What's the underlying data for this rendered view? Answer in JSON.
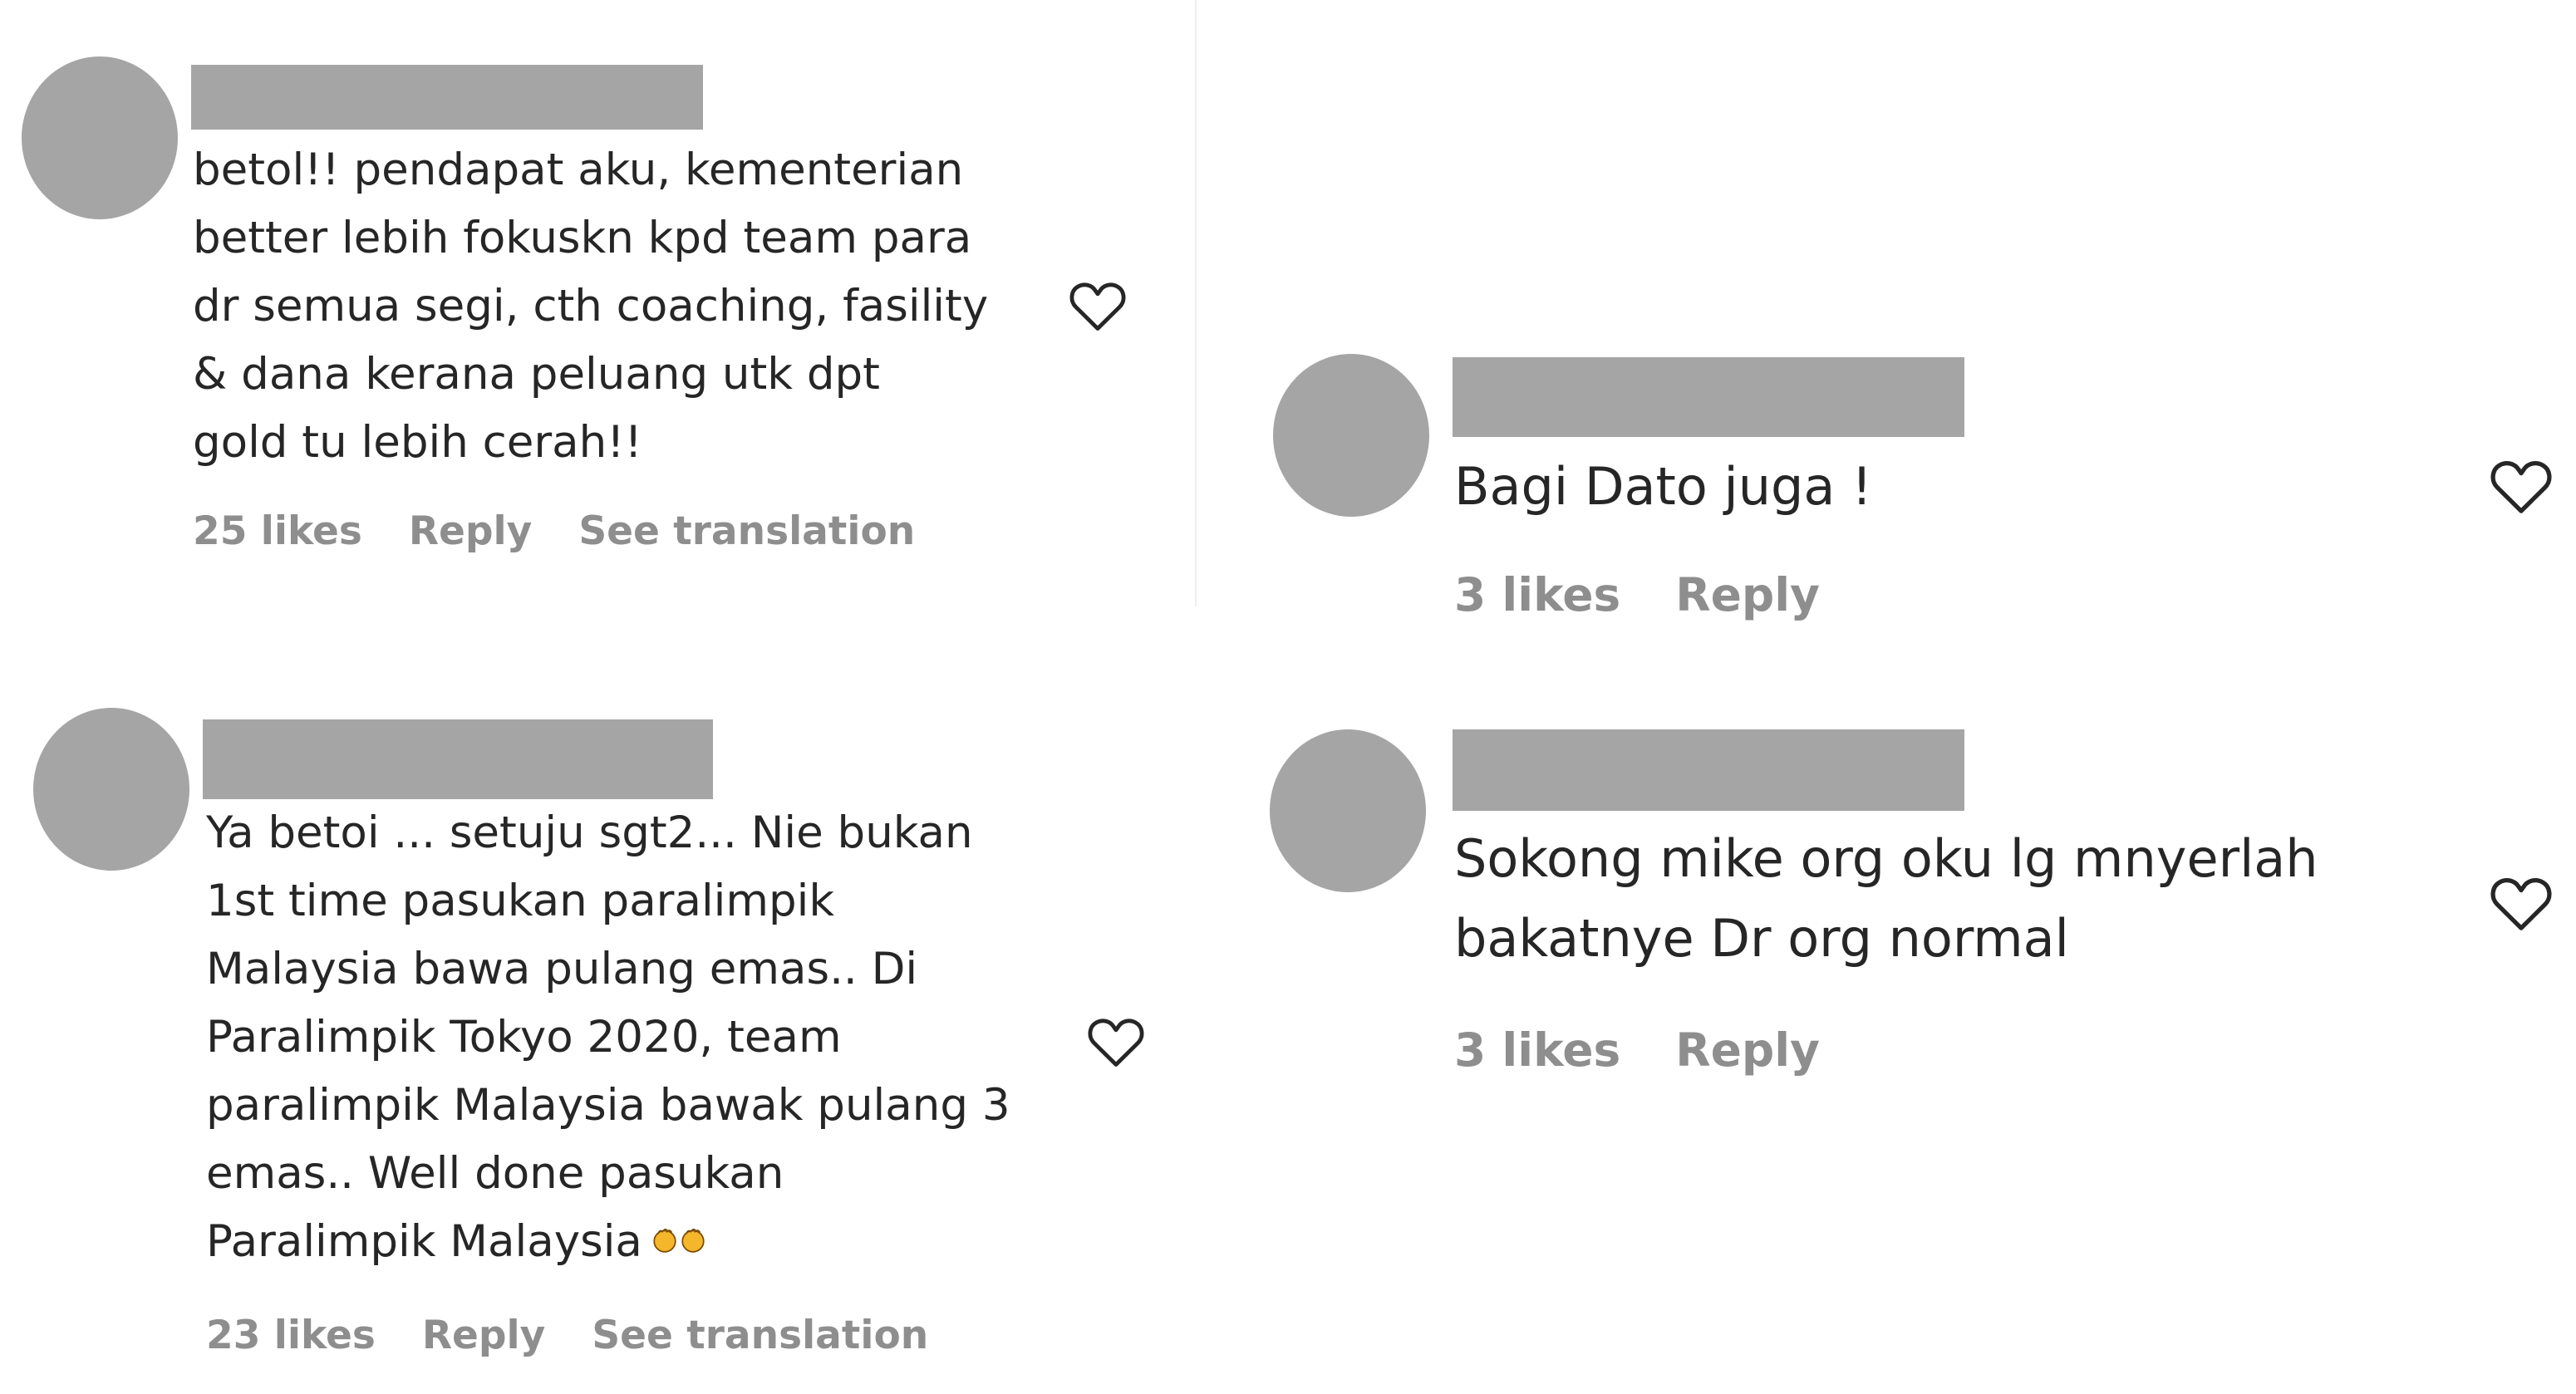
{
  "comments": [
    {
      "text": "betol!! pendapat aku, kementerian\nbetter lebih fokuskn kpd team para\ndr semua segi, cth coaching, fasility\n& dana kerana peluang utk dpt\ngold tu lebih cerah!!",
      "likes": "25 likes",
      "reply": "Reply",
      "translation": "See translation"
    },
    {
      "text": "Ya betoi ... setuju sgt2... Nie bukan\n1st time pasukan paralimpik\nMalaysia bawa pulang emas.. Di\nParalimpik Tokyo 2020, team\nparalimpik Malaysia bawak pulang 3\nemas.. Well done pasukan\nParalimpik Malaysia",
      "emoji": "clapping-hands-emoji",
      "likes": "23 likes",
      "reply": "Reply",
      "translation": "See translation"
    },
    {
      "text": "Bagi Dato juga !",
      "likes": "3 likes",
      "reply": "Reply"
    },
    {
      "text": "Sokong mike org oku lg mnyerlah\nbakatnye Dr org normal",
      "likes": "3 likes",
      "reply": "Reply"
    }
  ],
  "icons": {
    "like": "heart-outline-icon",
    "avatar": "redacted-avatar",
    "username": "redacted-username"
  },
  "colors": {
    "text": "#262626",
    "meta": "#8e8e8e",
    "redaction": "#a5a5a5",
    "heart": "#262626"
  }
}
